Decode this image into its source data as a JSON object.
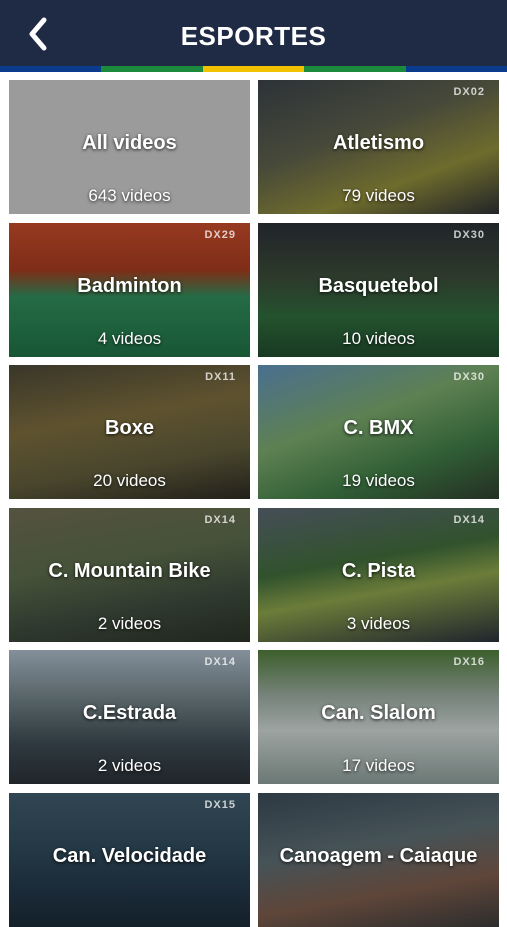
{
  "header": {
    "title": "ESPORTES",
    "back_icon": "chevron-left-icon",
    "background": "#1f2a44",
    "stripe_colors": [
      "#0a3b8c",
      "#1c8a3c",
      "#f2c200",
      "#1c8a3c",
      "#0a3b8c"
    ]
  },
  "tiles": [
    {
      "name": "All videos",
      "count": "643 videos",
      "tag": "",
      "bg": "#9b9b9b"
    },
    {
      "name": "Atletismo",
      "count": "79 videos",
      "tag": "DX02",
      "bg": "linear-gradient(160deg,#3a4148 0%,#5b5e4a 40%,#8e8a3a 70%,#2b2f33 100%)"
    },
    {
      "name": "Badminton",
      "count": "4 videos",
      "tag": "DX29",
      "bg": "linear-gradient(180deg,#c24a2a 0%,#a33a1e 35%,#2f8a5a 55%,#1f6f45 100%)"
    },
    {
      "name": "Basquetebol",
      "count": "10 videos",
      "tag": "DX30",
      "bg": "linear-gradient(180deg,#2a2f35 0%,#3a4a38 40%,#2f6a3c 70%,#1f4a2c 100%)"
    },
    {
      "name": "Boxe",
      "count": "20 videos",
      "tag": "DX11",
      "bg": "linear-gradient(170deg,#4a4636 0%,#7a6a3c 40%,#5e5a3a 70%,#2c2a22 100%)"
    },
    {
      "name": "C. BMX",
      "count": "19 videos",
      "tag": "DX30",
      "bg": "linear-gradient(160deg,#5f8fb8 0%,#79a56a 40%,#3f7a45 70%,#2e3d2e 100%)"
    },
    {
      "name": "C. Mountain Bike",
      "count": "2 videos",
      "tag": "DX14",
      "bg": "linear-gradient(170deg,#6d6a52 0%,#5a6a4a 40%,#3d4a3c 70%,#2a3226 100%)"
    },
    {
      "name": "C. Pista",
      "count": "3 videos",
      "tag": "DX14",
      "bg": "linear-gradient(170deg,#5a6470 0%,#3f6a3a 40%,#8aa04a 60%,#2a2f3a 100%)"
    },
    {
      "name": "C.Estrada",
      "count": "2 videos",
      "tag": "DX14",
      "bg": "linear-gradient(180deg,#a9b8c6 0%,#6a7a7e 40%,#3c4a52 70%,#2a3036 100%)"
    },
    {
      "name": "Can. Slalom",
      "count": "17 videos",
      "tag": "DX16",
      "bg": "linear-gradient(180deg,#4f7a3a 0%,#9aa9a0 35%,#c9d2cf 60%,#8a9a96 100%)"
    },
    {
      "name": "Can. Velocidade",
      "count": "",
      "tag": "DX15",
      "bg": "linear-gradient(180deg,#3f5a6a 0%,#2f4a5a 40%,#24384a 70%,#1a2a36 100%)"
    },
    {
      "name": "Canoagem - Caiaque",
      "count": "",
      "tag": "",
      "bg": "linear-gradient(170deg,#3a4a56 0%,#5a6a70 40%,#7a5a4a 70%,#3a3a3a 100%)"
    }
  ]
}
